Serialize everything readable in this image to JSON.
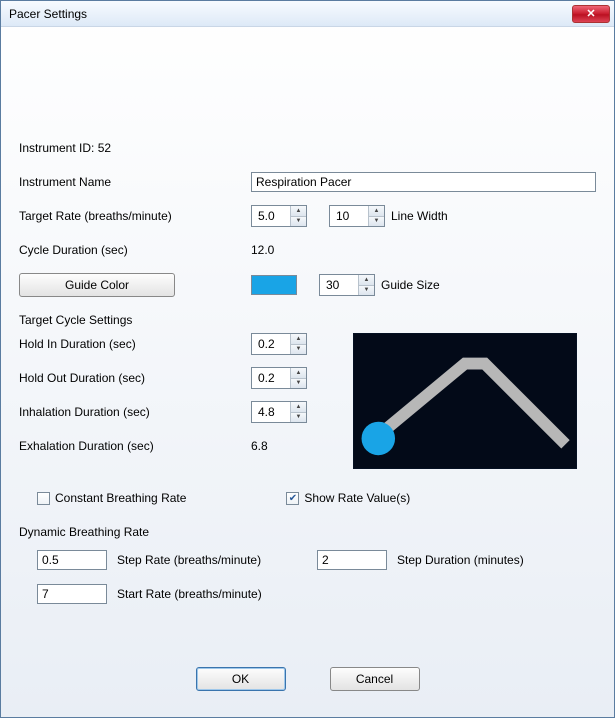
{
  "window": {
    "title": "Pacer Settings"
  },
  "labels": {
    "instrument_id_label": "Instrument ID:",
    "instrument_id_value": "52",
    "instrument_name": "Instrument Name",
    "target_rate": "Target Rate (breaths/minute)",
    "line_width": "Line Width",
    "cycle_duration": "Cycle Duration (sec)",
    "guide_color": "Guide Color",
    "guide_size": "Guide Size",
    "target_cycle_settings": "Target Cycle Settings",
    "hold_in": "Hold In Duration (sec)",
    "hold_out": "Hold Out Duration (sec)",
    "inhalation": "Inhalation Duration (sec)",
    "exhalation": "Exhalation Duration (sec)",
    "constant_rate": "Constant Breathing Rate",
    "show_rate_values": "Show Rate Value(s)",
    "dynamic_rate": "Dynamic Breathing Rate",
    "step_rate": "Step Rate (breaths/minute)",
    "step_duration": "Step Duration (minutes)",
    "start_rate": "Start Rate (breaths/minute)"
  },
  "values": {
    "instrument_name": "Respiration Pacer",
    "target_rate": "5.0",
    "line_width": "10",
    "cycle_duration": "12.0",
    "guide_size": "30",
    "hold_in": "0.2",
    "hold_out": "0.2",
    "inhalation": "4.8",
    "exhalation": "6.8",
    "step_rate": "0.5",
    "step_duration": "2",
    "start_rate": "7"
  },
  "colors": {
    "guide": "#19a4e6"
  },
  "checkboxes": {
    "constant_rate": false,
    "show_rate_values": true
  },
  "buttons": {
    "ok": "OK",
    "cancel": "Cancel"
  }
}
